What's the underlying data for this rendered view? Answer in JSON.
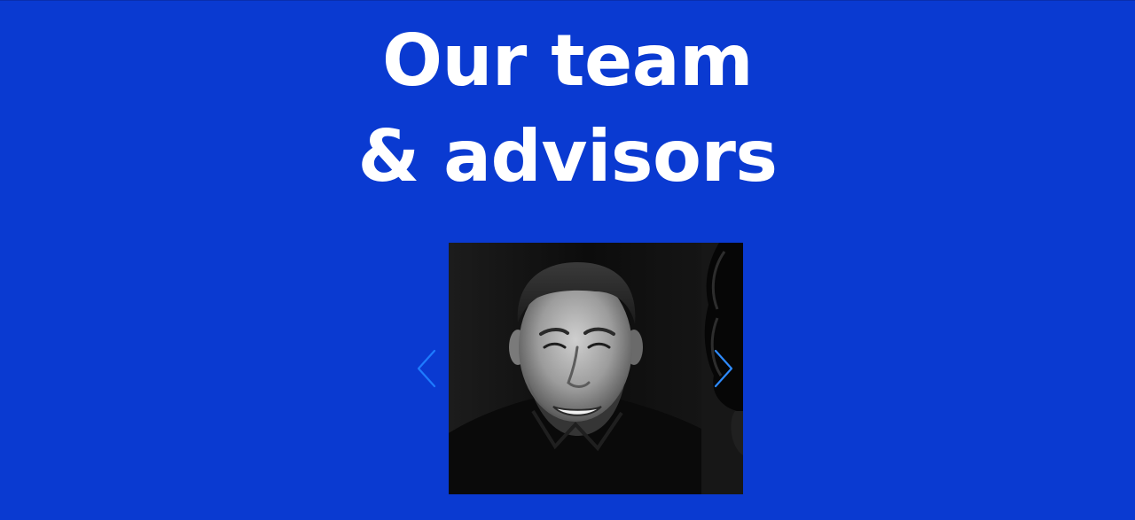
{
  "heading": {
    "line1": "Our team",
    "line2": "& advisors"
  },
  "carousel": {
    "current_slide": "team-member-photo",
    "next_slide": "team-member-photo-next"
  },
  "icons": {
    "prev": "chevron-left-icon",
    "next": "chevron-right-icon"
  },
  "colors": {
    "background": "#0A3AD1",
    "heading": "#FFFFFF",
    "arrow_prev": "#1E7BFF",
    "arrow_next": "#2E8BFF"
  }
}
